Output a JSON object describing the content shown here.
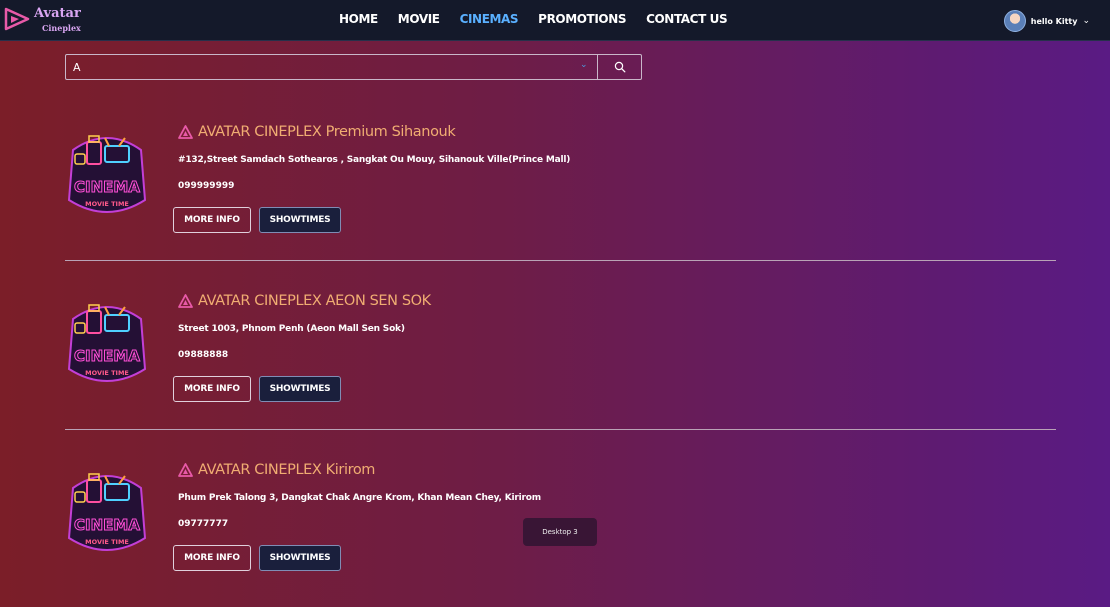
{
  "brand": {
    "title": "Avatar",
    "subtitle": "Cineplex"
  },
  "nav": {
    "items": [
      {
        "label": "HOME",
        "active": false
      },
      {
        "label": "MOVIE",
        "active": false
      },
      {
        "label": "CINEMAS",
        "active": true
      },
      {
        "label": "PROMOTIONS",
        "active": false
      },
      {
        "label": "CONTACT US",
        "active": false
      }
    ]
  },
  "user": {
    "greeting": "hello Kitty"
  },
  "search": {
    "value": "A"
  },
  "cinemas": [
    {
      "name": "AVATAR CINEPLEX Premium Sihanouk",
      "address": "#132,Street Samdach Sothearos , Sangkat Ou Mouy, Sihanouk Ville(Prince Mall)",
      "phone": "099999999",
      "more_info_label": "MORE INFO",
      "showtimes_label": "SHOWTIMES"
    },
    {
      "name": "AVATAR CINEPLEX AEON SEN SOK",
      "address": "Street 1003, Phnom Penh (Aeon Mall Sen Sok)",
      "phone": "09888888",
      "more_info_label": "MORE INFO",
      "showtimes_label": "SHOWTIMES"
    },
    {
      "name": "AVATAR CINEPLEX Kirirom",
      "address": "Phum Prek Talong 3, Dangkat Chak Angre Krom, Khan Mean Chey, Kirirom",
      "phone": "09777777",
      "more_info_label": "MORE INFO",
      "showtimes_label": "SHOWTIMES"
    }
  ],
  "thumbnail": {
    "line1": "CINEMA",
    "line2": "MOVIE TIME"
  },
  "tooltip": {
    "text": "Desktop 3"
  },
  "colors": {
    "nav_bg": "#14192a",
    "nav_active": "#5ab0ff",
    "cinema_name": "#f0ad72",
    "brand_pink": "#e85aa8",
    "bg_left": "#7b1e28",
    "bg_right": "#5a1b84"
  },
  "icons": {
    "logo": "play-triangle-logo-icon",
    "search": "search-icon",
    "dropdown": "chevron-down-icon",
    "cinema": "cinema-brand-icon"
  }
}
